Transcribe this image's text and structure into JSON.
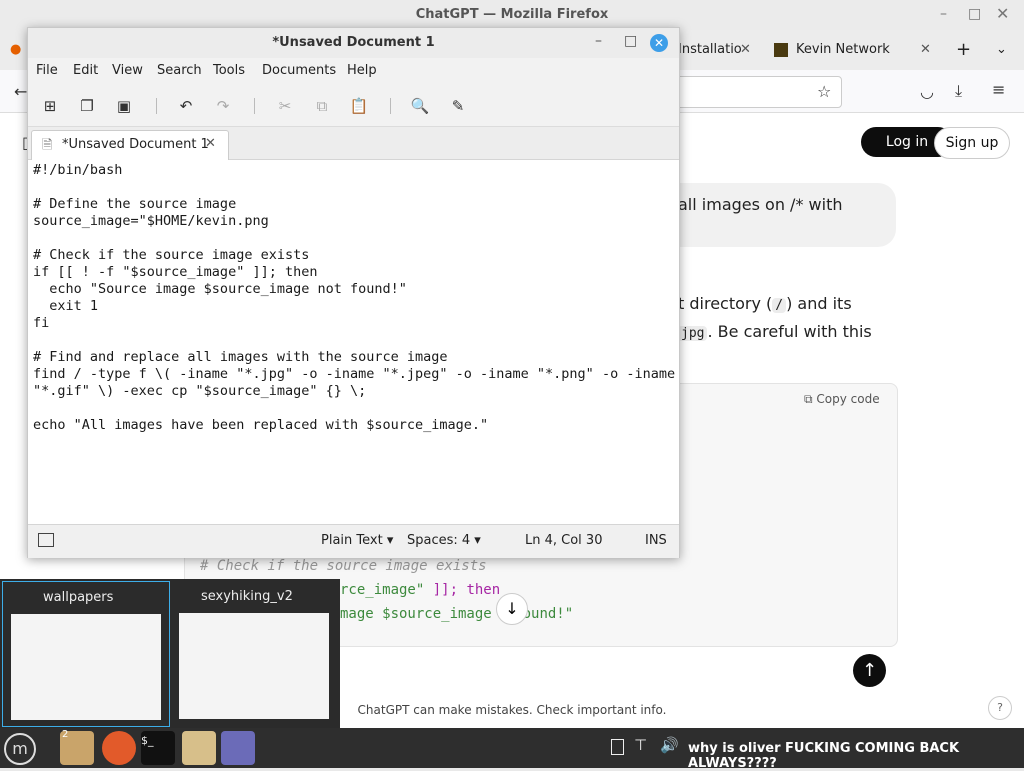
{
  "firefox": {
    "window_title": "ChatGPT — Mozilla Firefox",
    "tabs": [
      {
        "label": "Installatio"
      },
      {
        "label": "Kevin Network"
      }
    ]
  },
  "chat": {
    "login_label": "Log in",
    "signup_label": "Sign up",
    "user_message_fragment": "all images on /* with",
    "response_line1_a": "t directory (",
    "response_line1_code": "/",
    "response_line1_b": ") and its",
    "response_line2_code": "jpg",
    "response_line2_b": ". Be careful with this",
    "copy_code_label": "Copy code",
    "code_visible": [
      {
        "text": "# Check if the source image exists"
      },
      {
        "text_a": "rce_image\"",
        "text_b": " ]]; then"
      },
      {
        "text_a": "mage $source_image ",
        "text_b": " found!\""
      }
    ],
    "disclaimer": "ChatGPT can make mistakes. Check important info.",
    "help_label": "?"
  },
  "gedit": {
    "title": "*Unsaved Document 1",
    "menu": [
      "File",
      "Edit",
      "View",
      "Search",
      "Tools",
      "Documents",
      "Help"
    ],
    "tab_label": "*Unsaved Document 1",
    "lines": [
      "#!/bin/bash",
      "",
      "# Define the source image",
      "source_image=\"$HOME/kevin.png",
      "",
      "# Check if the source image exists",
      "if [[ ! -f \"$source_image\" ]]; then",
      "  echo \"Source image $source_image not found!\"",
      "  exit 1",
      "fi",
      "",
      "# Find and replace all images with the source image",
      "find / -type f \\( -iname \"*.jpg\" -o -iname \"*.jpeg\" -o -iname \"*.png\" -o -iname",
      "\"*.gif\" \\) -exec cp \"$source_image\" {} \\;",
      "",
      "echo \"All images have been replaced with $source_image.\""
    ],
    "status": {
      "language": "Plain Text",
      "spaces": "Spaces: 4",
      "position": "Ln 4, Col 30",
      "mode": "INS"
    }
  },
  "previews": [
    {
      "label": "wallpapers"
    },
    {
      "label": "sexyhiking_v2"
    }
  ],
  "taskbar": {
    "files_count": "2",
    "terminal_glyph": "$_",
    "status_text": "why is oliver FUCKING COMING BACK ALWAYS????"
  }
}
